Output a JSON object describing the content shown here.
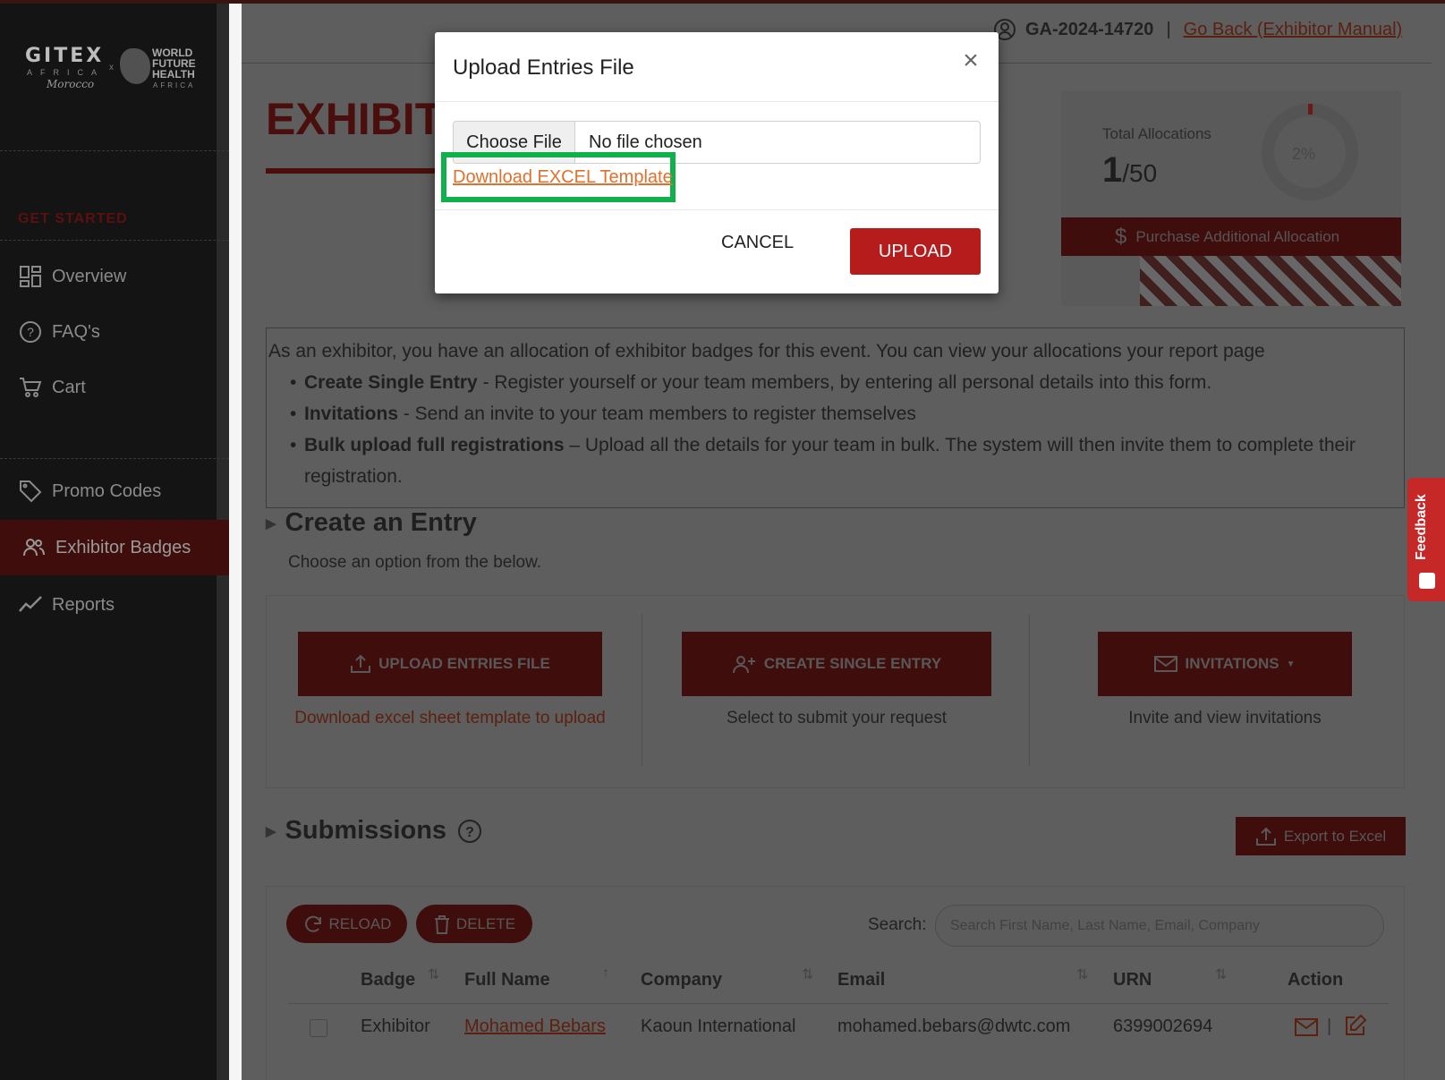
{
  "sidebar": {
    "logo": {
      "gitex": "GITEX",
      "africa": "AFRICA",
      "morocco": "Morocco",
      "x": "x",
      "wfh": "WORLD\nFUTURE\nHEALTH",
      "wfh_sub": "AFRICA"
    },
    "section_label": "GET STARTED",
    "items": [
      {
        "label": "Overview",
        "icon": "grid-icon"
      },
      {
        "label": "FAQ's",
        "icon": "question-icon"
      },
      {
        "label": "Cart",
        "icon": "cart-icon"
      },
      {
        "label": "Promo Codes",
        "icon": "tag-icon"
      },
      {
        "label": "Exhibitor Badges",
        "icon": "users-icon",
        "active": true
      },
      {
        "label": "Reports",
        "icon": "chart-line-icon"
      }
    ]
  },
  "header": {
    "account_id": "GA-2024-14720",
    "separator": "|",
    "back_link": "Go Back (Exhibitor Manual)"
  },
  "page": {
    "title": "EXHIBIT"
  },
  "allocation": {
    "label": "Total Allocations",
    "used": "1",
    "total": "/50",
    "percent": "2%",
    "purchase_label": "Purchase Additional Allocation"
  },
  "info": {
    "intro": "As an exhibitor, you have an allocation of exhibitor badges for this event. You can view your allocations your report page",
    "bullets": [
      {
        "bold": "Create Single Entry",
        "text": " - Register yourself or your team members, by entering all personal details into this form."
      },
      {
        "bold": "Invitations",
        "text": " - Send an invite to your team members to register themselves"
      },
      {
        "bold": "Bulk upload full registrations",
        "text": " – Upload all the details for your team in bulk. The system will then invite them to complete their registration."
      }
    ]
  },
  "create": {
    "title": "Create an Entry",
    "subtitle": "Choose an option from the below.",
    "options": [
      {
        "label": "UPLOAD ENTRIES FILE",
        "caption": "Download excel sheet template to upload"
      },
      {
        "label": "CREATE SINGLE ENTRY",
        "caption": "Select to submit your request"
      },
      {
        "label": "INVITATIONS",
        "caption": "Invite and view invitations"
      }
    ]
  },
  "submissions": {
    "title": "Submissions",
    "export_label": "Export to Excel",
    "reload_label": "RELOAD",
    "delete_label": "DELETE",
    "search_label": "Search:",
    "search_placeholder": "Search First Name, Last Name, Email, Company",
    "columns": [
      "Badge",
      "Full Name",
      "Company",
      "Email",
      "URN",
      "Action"
    ],
    "rows": [
      {
        "badge": "Exhibitor",
        "full_name": "Mohamed Bebars",
        "company": "Kaoun International",
        "email": "mohamed.bebars@dwtc.com",
        "urn": "6399002694"
      }
    ],
    "action_sep": "|"
  },
  "feedback": {
    "label": "Feedback"
  },
  "modal": {
    "title": "Upload Entries File",
    "choose_file": "Choose File",
    "no_file": "No file chosen",
    "template_link": "Download EXCEL Template",
    "cancel": "CANCEL",
    "upload": "UPLOAD"
  },
  "colors": {
    "brand_red": "#b71c1c",
    "link_orange": "#e0712c",
    "highlight_green": "#10b14b"
  }
}
